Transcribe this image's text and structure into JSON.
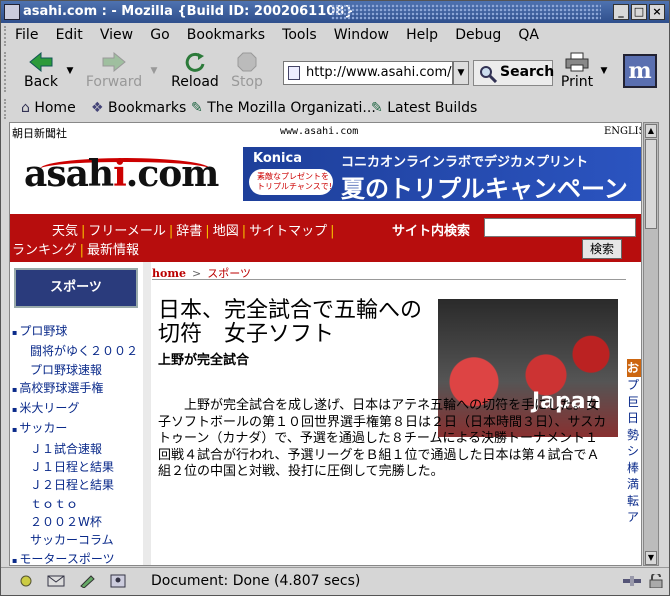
{
  "window": {
    "title": "asahi.com : - Mozilla {Build ID: 2002061108}",
    "min": "_",
    "max": "□",
    "close": "×"
  },
  "menu": [
    "File",
    "Edit",
    "View",
    "Go",
    "Bookmarks",
    "Tools",
    "Window",
    "Help",
    "Debug",
    "QA"
  ],
  "nav": {
    "back": "Back",
    "forward": "Forward",
    "reload": "Reload",
    "stop": "Stop",
    "url": "http://www.asahi.com/",
    "search": "Search",
    "print": "Print",
    "logo": "m"
  },
  "personal": {
    "home": "Home",
    "bookmarks": "Bookmarks",
    "mozilla": "The Mozilla Organizati...",
    "builds": "Latest Builds"
  },
  "page": {
    "publisher": "朝日新聞社",
    "site_url": "www.asahi.com",
    "english": "ENGLISH",
    "logo_main": "asah",
    "logo_i": "i",
    "logo_tail": ".com",
    "banner": {
      "brand": "Konica",
      "bubble": "素敵なプレゼントをトリプルチャンスで!",
      "line1": "コニカオンラインラボでデジカメプリント",
      "line2": "夏のトリプルキャンペーン"
    },
    "rednav_row1": [
      "天気",
      "フリーメール",
      "辞書",
      "地図",
      "サイトマップ"
    ],
    "rednav_row2": [
      "ランキング",
      "最新情報"
    ],
    "site_search_label": "サイト内検索",
    "search_button": "検索",
    "section": "スポーツ",
    "left_nav": [
      {
        "label": "プロ野球",
        "level": 0
      },
      {
        "label": "闘将がゆく２００２",
        "level": 1
      },
      {
        "label": "プロ野球速報",
        "level": 1
      },
      {
        "label": "高校野球選手権",
        "level": 0
      },
      {
        "label": "米大リーグ",
        "level": 0
      },
      {
        "label": "サッカー",
        "level": 0
      },
      {
        "label": "Ｊ１試合速報",
        "level": 1
      },
      {
        "label": "Ｊ１日程と結果",
        "level": 1
      },
      {
        "label": "Ｊ２日程と結果",
        "level": 1
      },
      {
        "label": "ｔｏｔｏ",
        "level": 1
      },
      {
        "label": "２００２W杯",
        "level": 1
      },
      {
        "label": "サッカーコラム",
        "level": 1
      },
      {
        "label": "モータースポーツ",
        "level": 0
      }
    ],
    "crumb_home": "home",
    "crumb_section": "スポーツ",
    "headline": "日本、完全試合で五輪への切符　女子ソフト",
    "subhead": "上野が完全試合",
    "photo_caption": "Japan",
    "body": "上野が完全試合を成し遂げ、日本はアテネ五輪への切符を手にした。女子ソフトボールの第１０回世界選手権第８日は２日（日本時間３日）、サスカトゥーン（カナダ）で、予選を通過した８チームによる決勝トーナメント１回戦４試合が行われ、予選リーグをＢ組１位で通過した日本は第４試合でＡ組２位の中国と対戦、投打に圧倒して完勝した。",
    "right_header": "お",
    "right_items": [
      "プ",
      "巨",
      "日",
      "勢",
      "シ",
      "棒",
      "満",
      "転",
      "ア"
    ]
  },
  "status": {
    "text": "Document: Done (4.807 secs)"
  }
}
